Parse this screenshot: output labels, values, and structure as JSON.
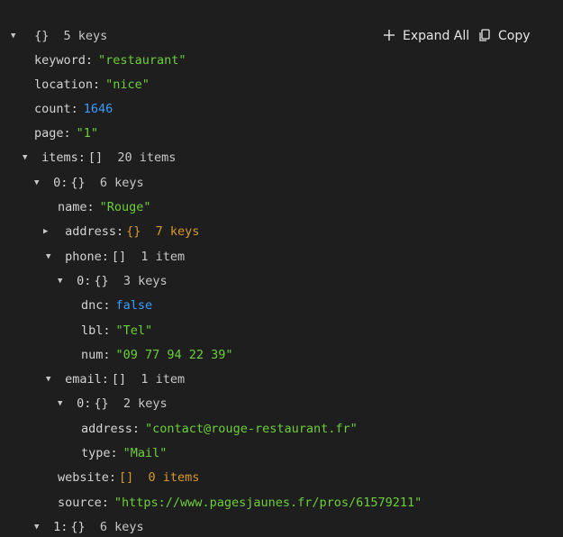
{
  "toolbar": {
    "expand_all_label": "Expand All",
    "copy_label": "Copy"
  },
  "root": {
    "brace": "{}",
    "meta": "5 keys"
  },
  "keyword": {
    "key": "keyword:",
    "value": "\"restaurant\""
  },
  "location": {
    "key": "location:",
    "value": "\"nice\""
  },
  "count": {
    "key": "count:",
    "value": "1646"
  },
  "page": {
    "key": "page:",
    "value": "\"1\""
  },
  "items": {
    "key": "items:",
    "brace": "[]",
    "meta": "20 items"
  },
  "item0": {
    "key": "0:",
    "brace": "{}",
    "meta": "6 keys",
    "name": {
      "key": "name:",
      "value": "\"Rouge\""
    },
    "address": {
      "key": "address:",
      "brace": "{}",
      "meta": "7 keys"
    },
    "phone": {
      "key": "phone:",
      "brace": "[]",
      "meta": "1 item",
      "entry": {
        "key": "0:",
        "brace": "{}",
        "meta": "3 keys",
        "dnc": {
          "key": "dnc:",
          "value": "false"
        },
        "lbl": {
          "key": "lbl:",
          "value": "\"Tel\""
        },
        "num": {
          "key": "num:",
          "value": "\"09 77 94 22 39\""
        }
      }
    },
    "email": {
      "key": "email:",
      "brace": "[]",
      "meta": "1 item",
      "entry": {
        "key": "0:",
        "brace": "{}",
        "meta": "2 keys",
        "address": {
          "key": "address:",
          "value": "\"contact@rouge-restaurant.fr\""
        },
        "type": {
          "key": "type:",
          "value": "\"Mail\""
        }
      }
    },
    "website": {
      "key": "website:",
      "brace": "[]",
      "meta": "0 items"
    },
    "source": {
      "key": "source:",
      "value": "\"https://www.pagesjaunes.fr/pros/61579211\""
    }
  },
  "item1": {
    "key": "1:",
    "brace": "{}",
    "meta": "6 keys"
  },
  "icons": {
    "expanded": "triangle-down-icon",
    "collapsed": "triangle-right-icon",
    "expand_all": "plus-icon",
    "copy": "copy-icon"
  },
  "colors": {
    "background": "#1e1e1e",
    "string": "#6ccf3a",
    "number": "#3b9cff",
    "collapsed_meta": "#d79a2a",
    "text": "#d4d4d4"
  }
}
